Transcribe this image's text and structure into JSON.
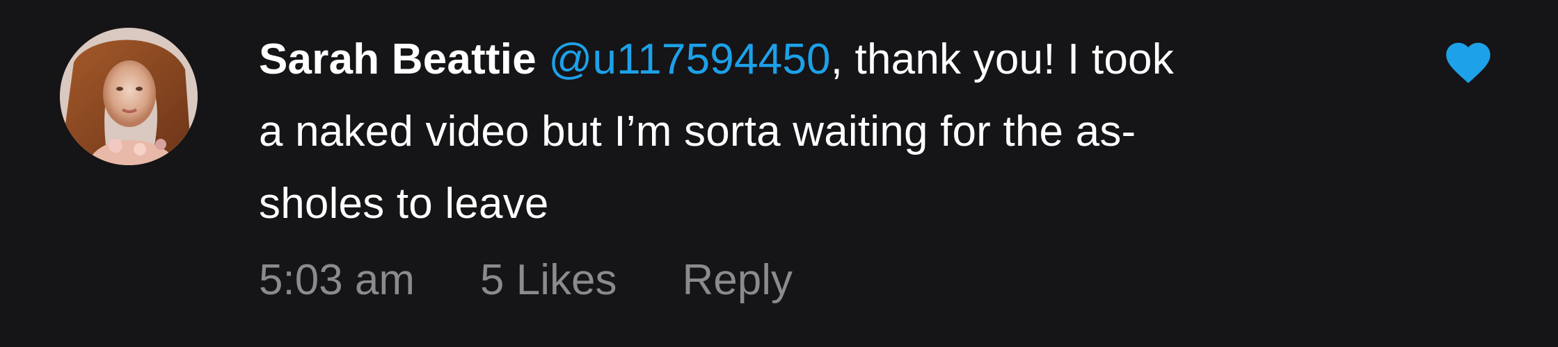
{
  "comment": {
    "author": "Sarah Beattie",
    "mention": "@u117594450",
    "text_line1_rest": ", thank you! I took",
    "text_line2": "a naked video but I’m sorta waiting for the as-",
    "text_line3": "sholes to leave",
    "timestamp": "5:03 am",
    "likes": "5 Likes",
    "reply": "Reply"
  },
  "colors": {
    "background": "#151417",
    "text": "#ffffff",
    "mention": "#1da1e8",
    "meta": "#8a8a8f",
    "heart": "#1da1e8"
  },
  "icons": {
    "like": "heart-icon",
    "avatar": "profile-avatar"
  }
}
